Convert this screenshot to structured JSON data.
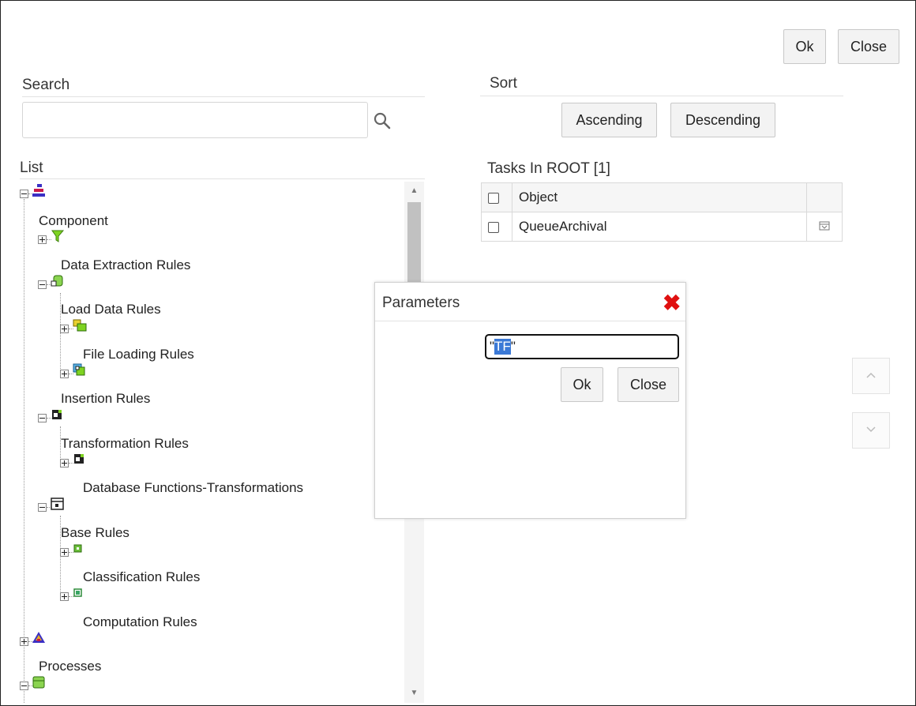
{
  "top_buttons": {
    "ok": "Ok",
    "close": "Close"
  },
  "search": {
    "title": "Search",
    "placeholder": "",
    "value": "",
    "icon": "search-icon"
  },
  "list": {
    "title": "List",
    "nodes": [
      {
        "label": "Component",
        "icon": "hierarchy-icon",
        "expander": "minus"
      },
      {
        "label": "Data Extraction Rules",
        "icon": "filter-icon",
        "expander": "plus"
      },
      {
        "label": "Load Data Rules",
        "icon": "database-icon",
        "expander": "minus"
      },
      {
        "label": "File Loading Rules",
        "icon": "file-load-icon",
        "expander": "plus"
      },
      {
        "label": "Insertion Rules",
        "icon": "insert-icon",
        "expander": "plus"
      },
      {
        "label": "Transformation Rules",
        "icon": "transform-icon",
        "expander": "minus"
      },
      {
        "label": "Database Functions-Transformations",
        "icon": "transform-icon",
        "expander": "plus"
      },
      {
        "label": "Base Rules",
        "icon": "rule-icon",
        "expander": "minus"
      },
      {
        "label": "Classification Rules",
        "icon": "classification-icon",
        "expander": "plus"
      },
      {
        "label": "Computation Rules",
        "icon": "computation-icon",
        "expander": "plus"
      },
      {
        "label": "Processes",
        "icon": "process-icon",
        "expander": "plus"
      },
      {
        "label": "",
        "icon": "stack-icon",
        "expander": "minus"
      }
    ]
  },
  "sort": {
    "title": "Sort",
    "ascending": "Ascending",
    "descending": "Descending"
  },
  "tasks": {
    "title": "Tasks In ROOT [1]",
    "column_object": "Object",
    "rows": [
      {
        "name": "QueueArchival"
      }
    ]
  },
  "dialog": {
    "title": "Parameters",
    "input_prefix": "\"",
    "input_selected": "TF",
    "input_suffix": "\"",
    "ok": "Ok",
    "close": "Close"
  },
  "colors": {
    "close_x": "#e01010",
    "selection": "#3b79d6"
  }
}
